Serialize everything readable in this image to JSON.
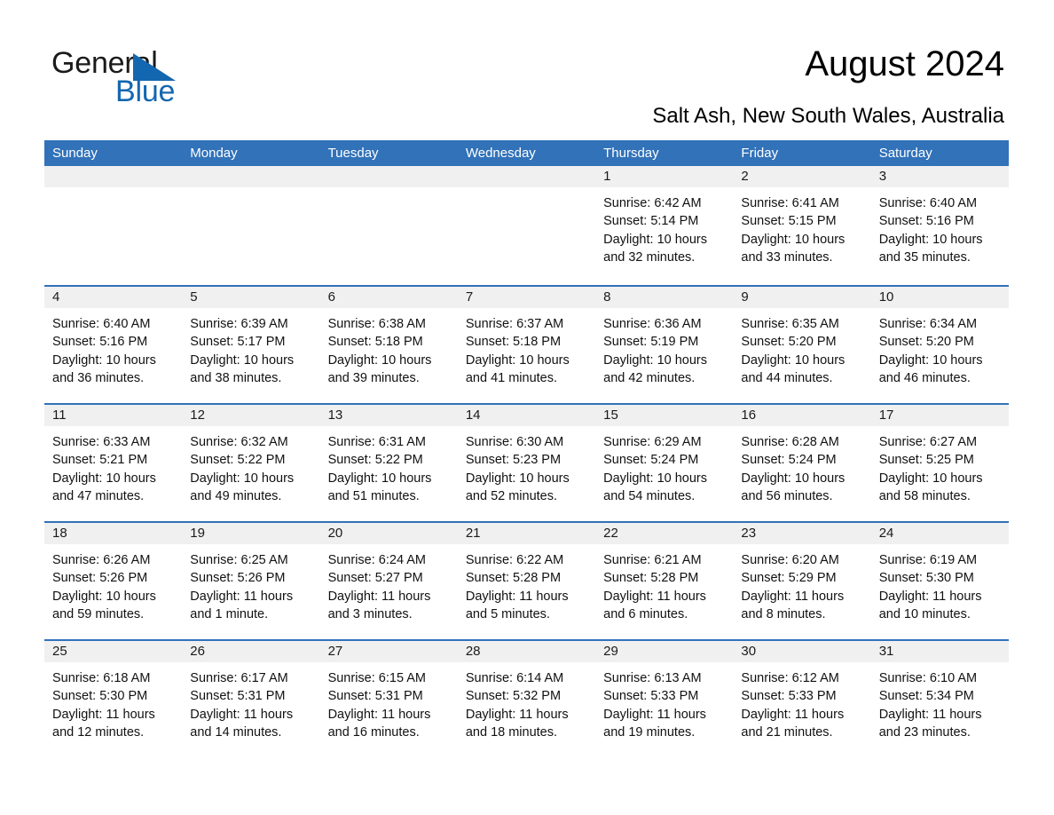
{
  "logo": {
    "word_one": "General",
    "word_two": "Blue",
    "triangle_color": "#1367b0",
    "text_color": "#1a1a1a"
  },
  "header": {
    "title": "August 2024",
    "location": "Salt Ash, New South Wales, Australia"
  },
  "theme": {
    "header_blue": "#3172b9",
    "row_rule_blue": "#3172b9",
    "day_band_gray": "#f0f0f0",
    "page_background": "#ffffff"
  },
  "calendar": {
    "weekdays": [
      "Sunday",
      "Monday",
      "Tuesday",
      "Wednesday",
      "Thursday",
      "Friday",
      "Saturday"
    ],
    "labels": {
      "sunrise": "Sunrise:",
      "sunset": "Sunset:",
      "daylight": "Daylight:"
    },
    "weeks": [
      [
        {
          "day": "",
          "empty": true
        },
        {
          "day": "",
          "empty": true
        },
        {
          "day": "",
          "empty": true
        },
        {
          "day": "",
          "empty": true
        },
        {
          "day": "1",
          "sunrise": "Sunrise: 6:42 AM",
          "sunset": "Sunset: 5:14 PM",
          "daylight_1": "Daylight: 10 hours",
          "daylight_2": "and 32 minutes."
        },
        {
          "day": "2",
          "sunrise": "Sunrise: 6:41 AM",
          "sunset": "Sunset: 5:15 PM",
          "daylight_1": "Daylight: 10 hours",
          "daylight_2": "and 33 minutes."
        },
        {
          "day": "3",
          "sunrise": "Sunrise: 6:40 AM",
          "sunset": "Sunset: 5:16 PM",
          "daylight_1": "Daylight: 10 hours",
          "daylight_2": "and 35 minutes."
        }
      ],
      [
        {
          "day": "4",
          "sunrise": "Sunrise: 6:40 AM",
          "sunset": "Sunset: 5:16 PM",
          "daylight_1": "Daylight: 10 hours",
          "daylight_2": "and 36 minutes."
        },
        {
          "day": "5",
          "sunrise": "Sunrise: 6:39 AM",
          "sunset": "Sunset: 5:17 PM",
          "daylight_1": "Daylight: 10 hours",
          "daylight_2": "and 38 minutes."
        },
        {
          "day": "6",
          "sunrise": "Sunrise: 6:38 AM",
          "sunset": "Sunset: 5:18 PM",
          "daylight_1": "Daylight: 10 hours",
          "daylight_2": "and 39 minutes."
        },
        {
          "day": "7",
          "sunrise": "Sunrise: 6:37 AM",
          "sunset": "Sunset: 5:18 PM",
          "daylight_1": "Daylight: 10 hours",
          "daylight_2": "and 41 minutes."
        },
        {
          "day": "8",
          "sunrise": "Sunrise: 6:36 AM",
          "sunset": "Sunset: 5:19 PM",
          "daylight_1": "Daylight: 10 hours",
          "daylight_2": "and 42 minutes."
        },
        {
          "day": "9",
          "sunrise": "Sunrise: 6:35 AM",
          "sunset": "Sunset: 5:20 PM",
          "daylight_1": "Daylight: 10 hours",
          "daylight_2": "and 44 minutes."
        },
        {
          "day": "10",
          "sunrise": "Sunrise: 6:34 AM",
          "sunset": "Sunset: 5:20 PM",
          "daylight_1": "Daylight: 10 hours",
          "daylight_2": "and 46 minutes."
        }
      ],
      [
        {
          "day": "11",
          "sunrise": "Sunrise: 6:33 AM",
          "sunset": "Sunset: 5:21 PM",
          "daylight_1": "Daylight: 10 hours",
          "daylight_2": "and 47 minutes."
        },
        {
          "day": "12",
          "sunrise": "Sunrise: 6:32 AM",
          "sunset": "Sunset: 5:22 PM",
          "daylight_1": "Daylight: 10 hours",
          "daylight_2": "and 49 minutes."
        },
        {
          "day": "13",
          "sunrise": "Sunrise: 6:31 AM",
          "sunset": "Sunset: 5:22 PM",
          "daylight_1": "Daylight: 10 hours",
          "daylight_2": "and 51 minutes."
        },
        {
          "day": "14",
          "sunrise": "Sunrise: 6:30 AM",
          "sunset": "Sunset: 5:23 PM",
          "daylight_1": "Daylight: 10 hours",
          "daylight_2": "and 52 minutes."
        },
        {
          "day": "15",
          "sunrise": "Sunrise: 6:29 AM",
          "sunset": "Sunset: 5:24 PM",
          "daylight_1": "Daylight: 10 hours",
          "daylight_2": "and 54 minutes."
        },
        {
          "day": "16",
          "sunrise": "Sunrise: 6:28 AM",
          "sunset": "Sunset: 5:24 PM",
          "daylight_1": "Daylight: 10 hours",
          "daylight_2": "and 56 minutes."
        },
        {
          "day": "17",
          "sunrise": "Sunrise: 6:27 AM",
          "sunset": "Sunset: 5:25 PM",
          "daylight_1": "Daylight: 10 hours",
          "daylight_2": "and 58 minutes."
        }
      ],
      [
        {
          "day": "18",
          "sunrise": "Sunrise: 6:26 AM",
          "sunset": "Sunset: 5:26 PM",
          "daylight_1": "Daylight: 10 hours",
          "daylight_2": "and 59 minutes."
        },
        {
          "day": "19",
          "sunrise": "Sunrise: 6:25 AM",
          "sunset": "Sunset: 5:26 PM",
          "daylight_1": "Daylight: 11 hours",
          "daylight_2": "and 1 minute."
        },
        {
          "day": "20",
          "sunrise": "Sunrise: 6:24 AM",
          "sunset": "Sunset: 5:27 PM",
          "daylight_1": "Daylight: 11 hours",
          "daylight_2": "and 3 minutes."
        },
        {
          "day": "21",
          "sunrise": "Sunrise: 6:22 AM",
          "sunset": "Sunset: 5:28 PM",
          "daylight_1": "Daylight: 11 hours",
          "daylight_2": "and 5 minutes."
        },
        {
          "day": "22",
          "sunrise": "Sunrise: 6:21 AM",
          "sunset": "Sunset: 5:28 PM",
          "daylight_1": "Daylight: 11 hours",
          "daylight_2": "and 6 minutes."
        },
        {
          "day": "23",
          "sunrise": "Sunrise: 6:20 AM",
          "sunset": "Sunset: 5:29 PM",
          "daylight_1": "Daylight: 11 hours",
          "daylight_2": "and 8 minutes."
        },
        {
          "day": "24",
          "sunrise": "Sunrise: 6:19 AM",
          "sunset": "Sunset: 5:30 PM",
          "daylight_1": "Daylight: 11 hours",
          "daylight_2": "and 10 minutes."
        }
      ],
      [
        {
          "day": "25",
          "sunrise": "Sunrise: 6:18 AM",
          "sunset": "Sunset: 5:30 PM",
          "daylight_1": "Daylight: 11 hours",
          "daylight_2": "and 12 minutes."
        },
        {
          "day": "26",
          "sunrise": "Sunrise: 6:17 AM",
          "sunset": "Sunset: 5:31 PM",
          "daylight_1": "Daylight: 11 hours",
          "daylight_2": "and 14 minutes."
        },
        {
          "day": "27",
          "sunrise": "Sunrise: 6:15 AM",
          "sunset": "Sunset: 5:31 PM",
          "daylight_1": "Daylight: 11 hours",
          "daylight_2": "and 16 minutes."
        },
        {
          "day": "28",
          "sunrise": "Sunrise: 6:14 AM",
          "sunset": "Sunset: 5:32 PM",
          "daylight_1": "Daylight: 11 hours",
          "daylight_2": "and 18 minutes."
        },
        {
          "day": "29",
          "sunrise": "Sunrise: 6:13 AM",
          "sunset": "Sunset: 5:33 PM",
          "daylight_1": "Daylight: 11 hours",
          "daylight_2": "and 19 minutes."
        },
        {
          "day": "30",
          "sunrise": "Sunrise: 6:12 AM",
          "sunset": "Sunset: 5:33 PM",
          "daylight_1": "Daylight: 11 hours",
          "daylight_2": "and 21 minutes."
        },
        {
          "day": "31",
          "sunrise": "Sunrise: 6:10 AM",
          "sunset": "Sunset: 5:34 PM",
          "daylight_1": "Daylight: 11 hours",
          "daylight_2": "and 23 minutes."
        }
      ]
    ]
  }
}
